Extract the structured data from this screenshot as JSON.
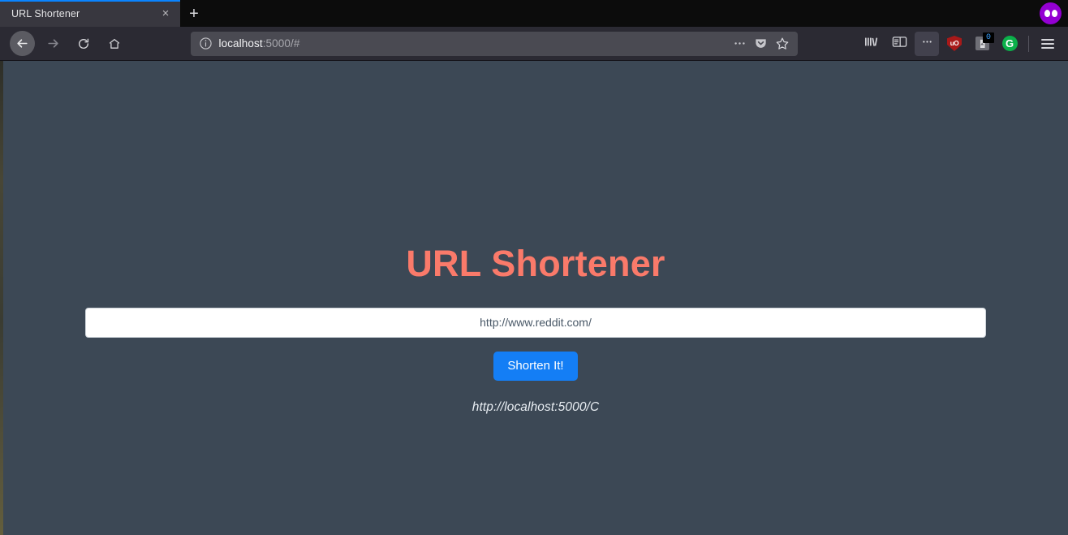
{
  "browser": {
    "tab": {
      "title": "URL Shortener",
      "close_label": "×"
    },
    "new_tab_label": "+",
    "private_mode_icon": "mask-icon",
    "nav": {
      "back_icon": "back-arrow-icon",
      "forward_icon": "forward-arrow-icon",
      "reload_icon": "reload-icon",
      "home_icon": "home-icon"
    },
    "address_bar": {
      "identity_icon": "info-circle-icon",
      "host": "localhost",
      "path": ":5000/#",
      "full_url": "localhost:5000/#",
      "page_actions_icon": "ellipsis-icon",
      "pocket_icon": "pocket-icon",
      "bookmark_icon": "star-icon"
    },
    "toolbar": {
      "library_icon": "library-icon",
      "sidebar_icon": "sidebar-icon",
      "page_actions_icon": "ellipsis-boxed-icon",
      "extensions": [
        {
          "name": "ublock-origin-icon",
          "label": "uO"
        },
        {
          "name": "extension-icon",
          "label": "",
          "badge": "0"
        },
        {
          "name": "grammarly-icon",
          "label": "G"
        }
      ],
      "menu_icon": "hamburger-menu-icon"
    }
  },
  "page": {
    "title": "URL Shortener",
    "input": {
      "value": "http://www.reddit.com/",
      "placeholder": "http://www.reddit.com/"
    },
    "submit_label": "Shorten It!",
    "result": "http://localhost:5000/C",
    "colors": {
      "background": "#3c4855",
      "title": "#fa7a6a",
      "button": "#147ef5",
      "result_text": "#e9eef3"
    }
  }
}
